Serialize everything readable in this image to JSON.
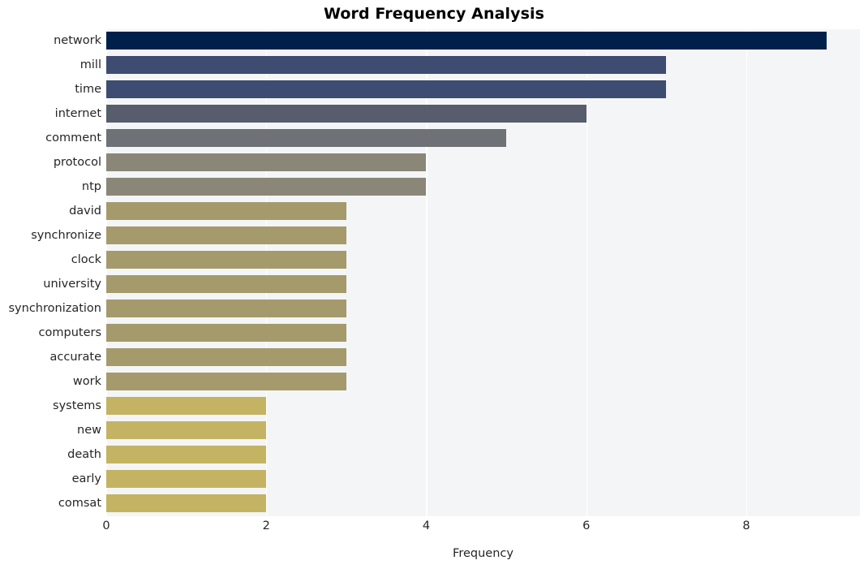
{
  "chart_data": {
    "type": "bar",
    "orientation": "horizontal",
    "title": "Word Frequency Analysis",
    "xlabel": "Frequency",
    "ylabel": "",
    "categories": [
      "network",
      "mill",
      "time",
      "internet",
      "comment",
      "protocol",
      "ntp",
      "david",
      "synchronize",
      "clock",
      "university",
      "synchronization",
      "computers",
      "accurate",
      "work",
      "systems",
      "new",
      "death",
      "early",
      "comsat"
    ],
    "values": [
      9,
      7,
      7,
      6,
      5,
      4,
      4,
      3,
      3,
      3,
      3,
      3,
      3,
      3,
      3,
      2,
      2,
      2,
      2,
      2
    ],
    "colors": [
      "#00204c",
      "#3e4c71",
      "#3e4c71",
      "#575d6d",
      "#6e7176",
      "#8a8779",
      "#8a8779",
      "#a49a6c",
      "#a49a6c",
      "#a49a6c",
      "#a49a6c",
      "#a49a6c",
      "#a49a6c",
      "#a49a6c",
      "#a49a6c",
      "#c4b363",
      "#c4b363",
      "#c4b363",
      "#c4b363",
      "#c4b363"
    ],
    "xlim": [
      0,
      9.42
    ],
    "xticks": [
      0,
      2,
      4,
      6,
      8
    ],
    "xtick_labels": [
      "0",
      "2",
      "4",
      "6",
      "8"
    ],
    "grid": true,
    "grid_axis": "x",
    "legend": null,
    "colormap": "cividis",
    "style": "whitegrid",
    "plot_background": "#f4f5f6",
    "gridline_color": "#ffffff",
    "text_color": "#262626",
    "title_color": "#000000"
  }
}
